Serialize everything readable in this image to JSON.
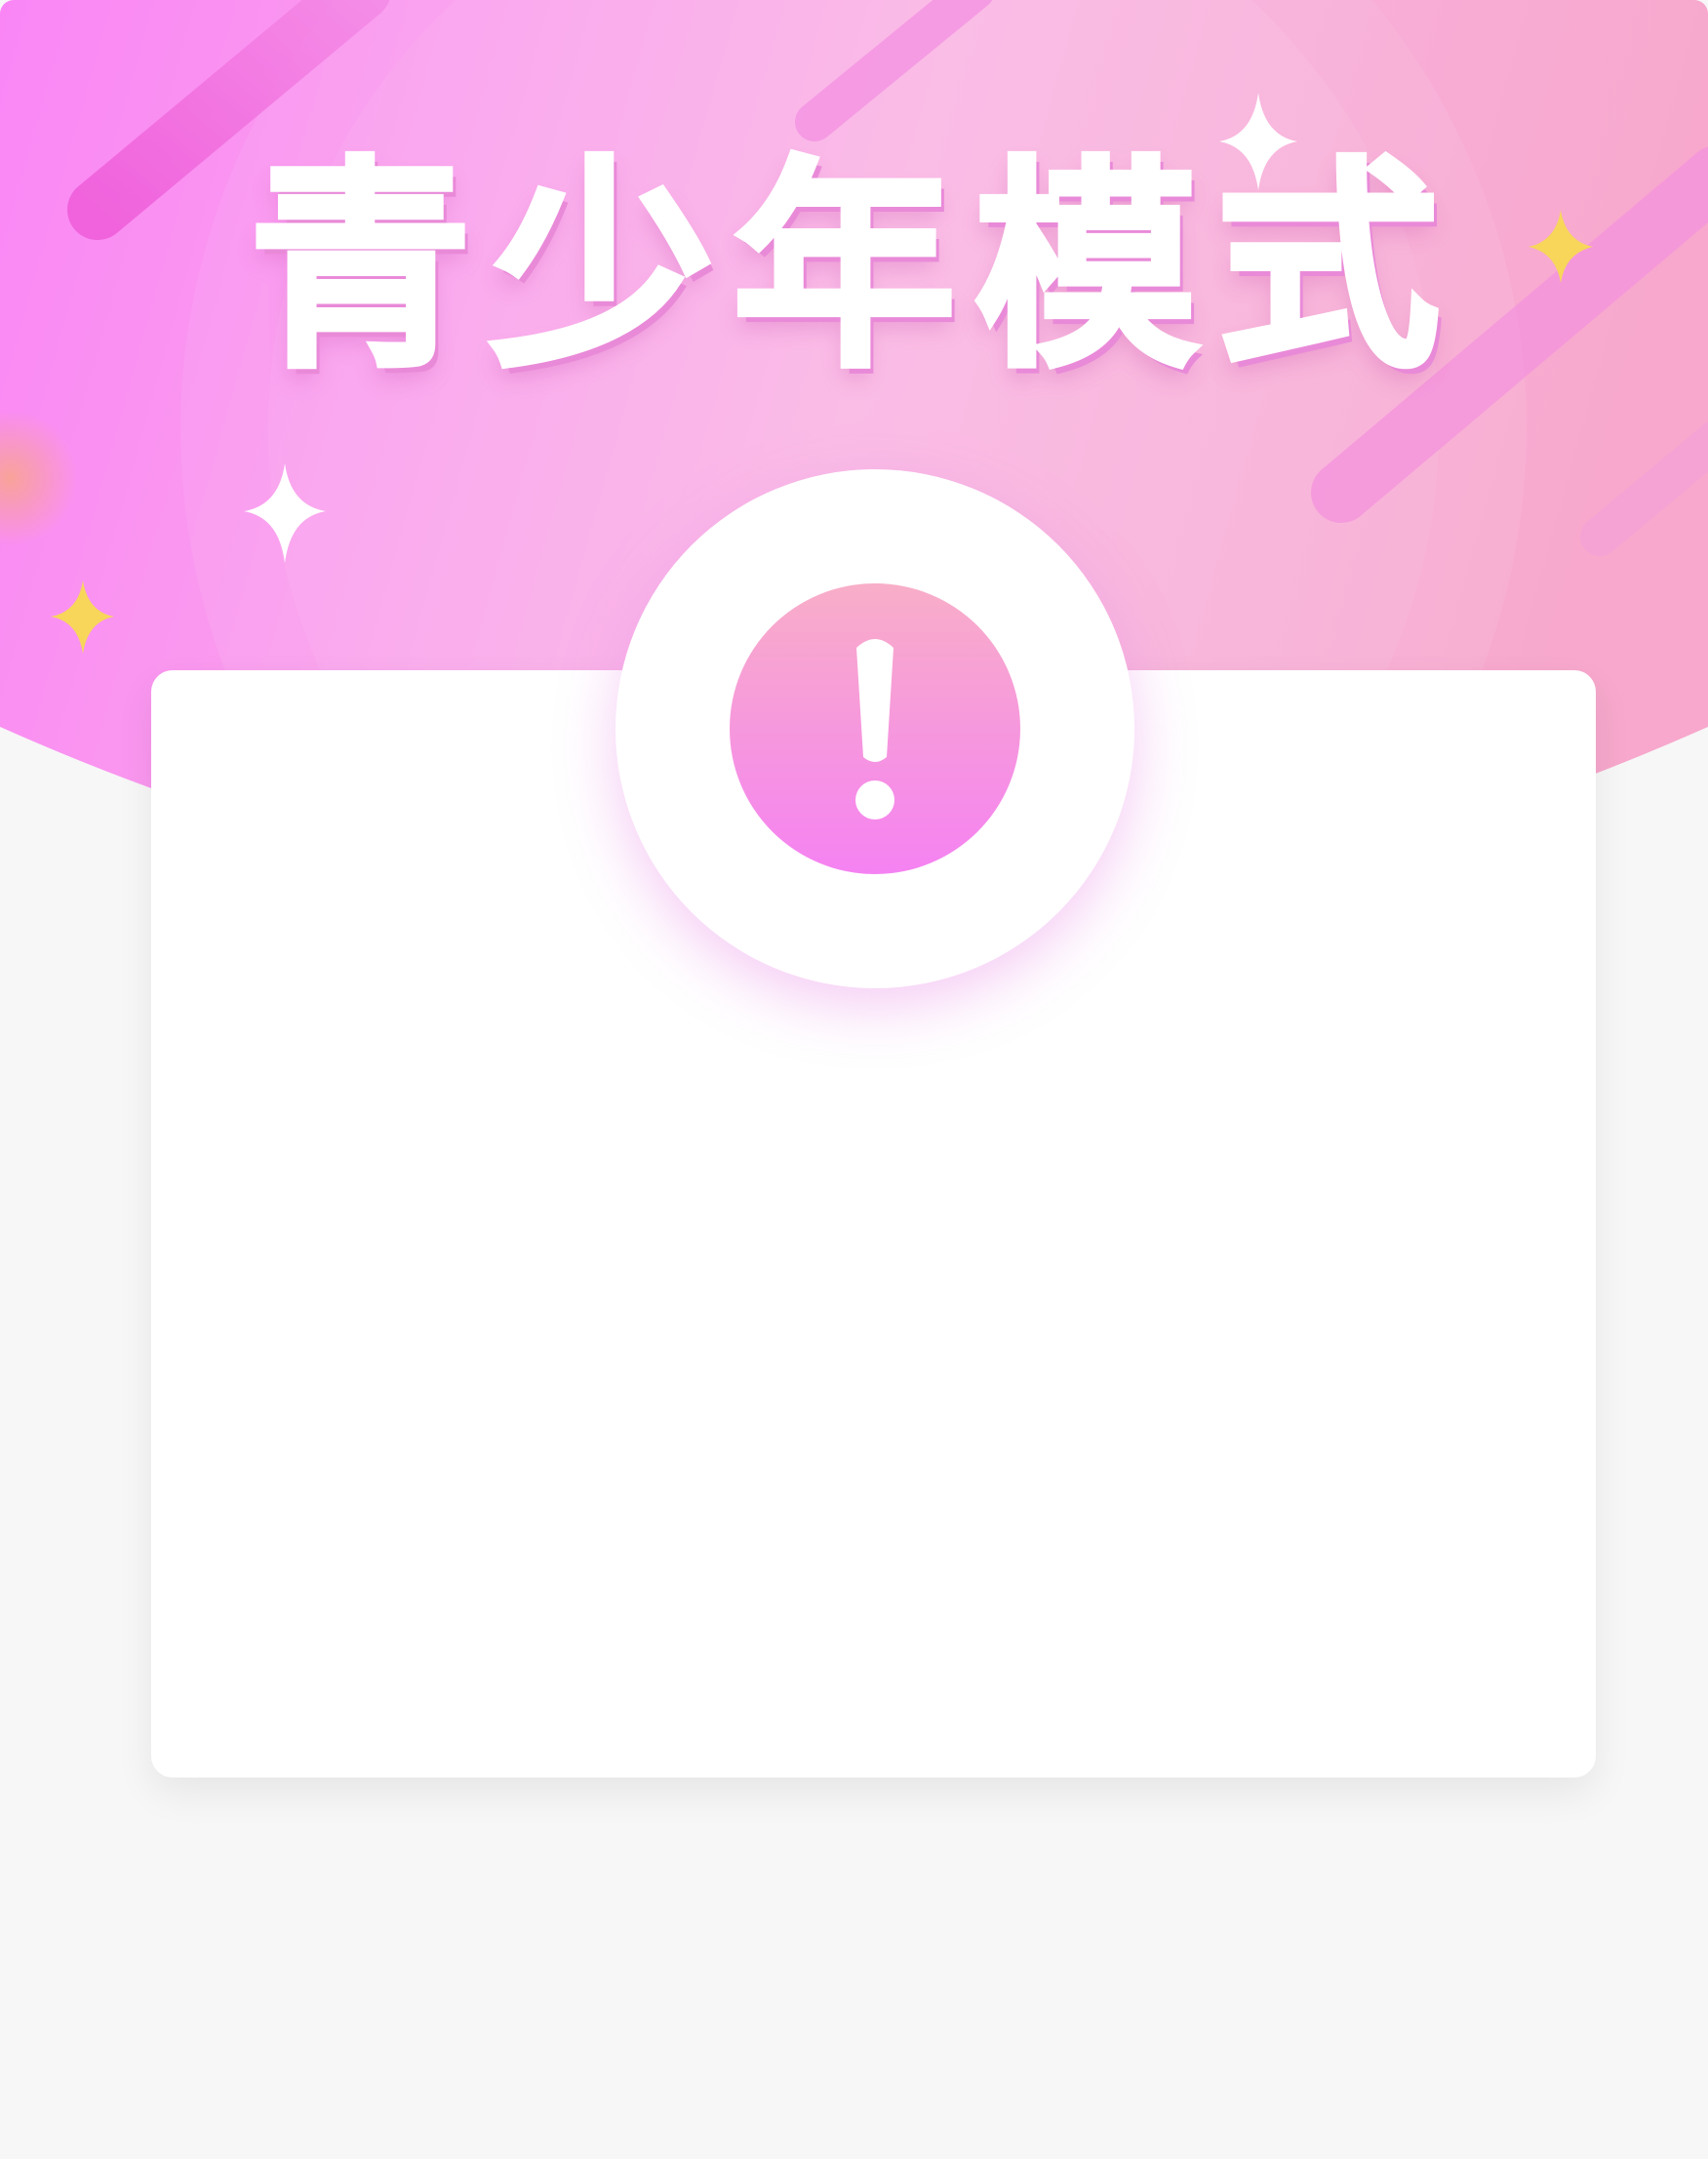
{
  "header": {
    "title": "青少年模式",
    "gradient_colors": [
      "#fa86f6",
      "#fab4e4",
      "#f7a8cc"
    ],
    "sparkle_color_white": "#ffffff",
    "sparkle_color_yellow": "#f7d65a"
  },
  "alert": {
    "icon": "exclamation-icon",
    "disc_colors": [
      "#f8aec8",
      "#f582f2"
    ]
  },
  "card": {
    "background": "#ffffff"
  },
  "page": {
    "background": "#f7f7f7"
  }
}
